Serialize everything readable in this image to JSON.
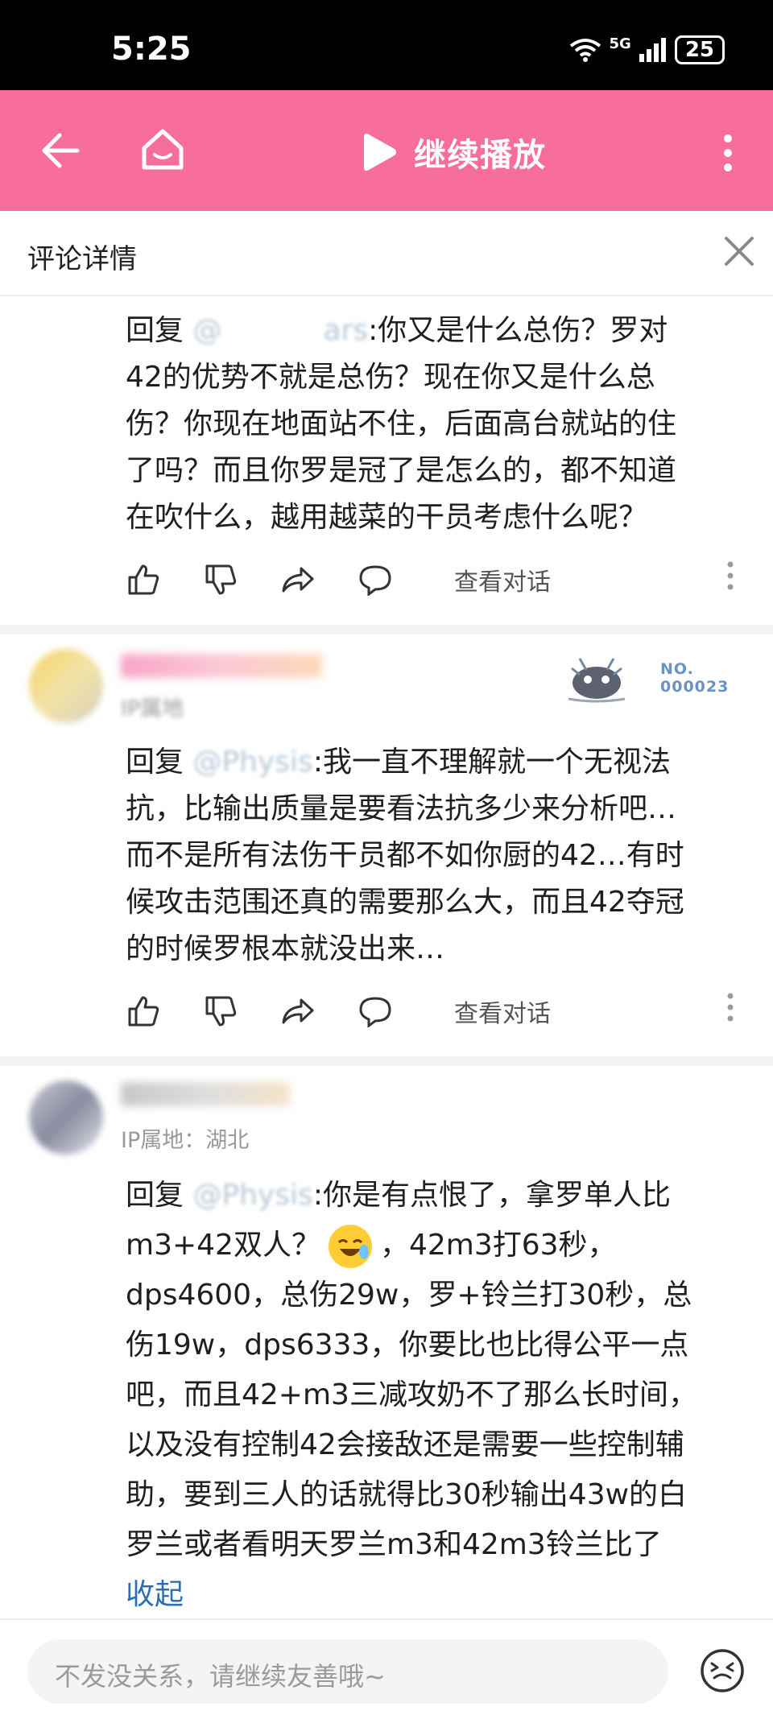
{
  "status_bar": {
    "time": "5:25",
    "network": "5G",
    "battery": "25"
  },
  "header": {
    "play_label": "继续播放"
  },
  "detail": {
    "title": "评论详情"
  },
  "comments": [
    {
      "reply_prefix": "回复",
      "mention": "@       ars",
      "text_first": ":你又是什么总伤？罗对",
      "lines": [
        "42的优势不就是总伤？现在你又是什么总",
        "伤？你现在地面站不住，后面高台就站的住",
        "了吗？而且你罗是冠了是怎么的，都不知道",
        "在吹什么，越用越菜的干员考虑什么呢？"
      ],
      "view_label": "查看对话"
    },
    {
      "meta": "IP属地",
      "badge_no": "NO.",
      "badge_num": "000023",
      "reply_prefix": "回复",
      "mention": "@Physis",
      "text_first": ":我一直不理解就一个无视法",
      "lines": [
        "抗，比输出质量是要看法抗多少来分析吧…",
        "而不是所有法伤干员都不如你厨的42…有时",
        "候攻击范围还真的需要那么大，而且42夺冠",
        "的时候罗根本就没出来…"
      ],
      "view_label": "查看对话"
    },
    {
      "meta": "IP属地：湖北",
      "reply_prefix": "回复",
      "mention": "@Physis",
      "text_first": ":你是有点恨了，拿罗单人比",
      "line2_a": "m3+42双人？",
      "line2_b": "，42m3打63秒，",
      "lines": [
        "dps4600，总伤29w，罗+铃兰打30秒，总",
        "伤19w，dps6333，你要比也比得公平一点",
        "吧，而且42+m3三减攻奶不了那么长时间，",
        "以及没有控制42会接敌还是需要一些控制辅",
        "助，要到三人的话就得比30秒输出43w的白",
        "罗兰或者看明天罗兰m3和42m3铃兰比了"
      ],
      "collapse": "收起"
    }
  ],
  "footer": {
    "placeholder": "不发没关系，请继续友善哦~"
  },
  "colors": {
    "header_pink": "#f76e9b",
    "link_blue": "#2a6fb8"
  }
}
